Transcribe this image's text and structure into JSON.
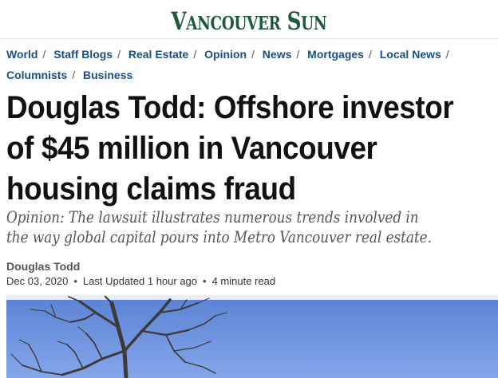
{
  "masthead": {
    "logo_text": "Vancouver Sun",
    "logo_first_initial": "V",
    "logo_first_rest": "ANCOUVER",
    "logo_second_initial": "S",
    "logo_second_rest": "UN",
    "brand_color": "#1f5b3b"
  },
  "breadcrumb": [
    {
      "label": "World"
    },
    {
      "label": "Staff Blogs"
    },
    {
      "label": "Real Estate"
    },
    {
      "label": "Opinion"
    },
    {
      "label": "News"
    },
    {
      "label": "Mortgages"
    },
    {
      "label": "Local News"
    },
    {
      "label": "Columnists"
    },
    {
      "label": "Business"
    }
  ],
  "separator": "/",
  "article": {
    "headline": "Douglas Todd: Offshore investor of $45 million in Vancouver housing claims fraud",
    "dek": "Opinion: The lawsuit illustrates numerous trends involved in the way global capital pours into Metro Vancouver real estate.",
    "author": "Douglas Todd",
    "date": "Dec 03, 2020",
    "updated": "Last Updated 1 hour ago",
    "read_time": "4 minute read",
    "meta_dot": "•"
  },
  "colors": {
    "link": "#1a4f86",
    "headline": "#111111",
    "sky": "#6c93e0"
  }
}
